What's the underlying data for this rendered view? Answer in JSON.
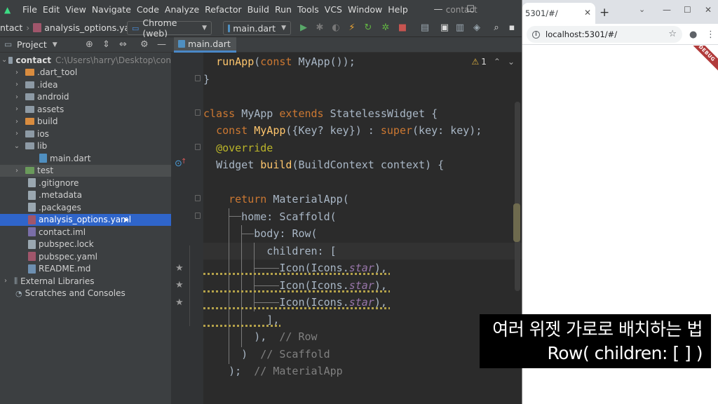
{
  "ide": {
    "menu": [
      "File",
      "Edit",
      "View",
      "Navigate",
      "Code",
      "Analyze",
      "Refactor",
      "Build",
      "Run",
      "Tools",
      "VCS",
      "Window",
      "Help"
    ],
    "project_name": "contact",
    "breadcrumb": {
      "root": "ntact",
      "file": "analysis_options.yaml"
    },
    "device_selector": "Chrome (web)",
    "run_config": "main.dart",
    "project_panel_label": "Project",
    "tree": [
      {
        "label": "contact",
        "path": "C:\\Users\\harry\\Desktop\\con",
        "icon": "folder",
        "expanded": true,
        "depth": 0
      },
      {
        "label": ".dart_tool",
        "icon": "folder-orange",
        "depth": 1
      },
      {
        "label": ".idea",
        "icon": "folder",
        "depth": 1
      },
      {
        "label": "android",
        "icon": "folder",
        "depth": 1
      },
      {
        "label": "assets",
        "icon": "folder",
        "depth": 1
      },
      {
        "label": "build",
        "icon": "folder-orange",
        "depth": 1
      },
      {
        "label": "ios",
        "icon": "folder",
        "depth": 1
      },
      {
        "label": "lib",
        "icon": "folder",
        "expanded": true,
        "depth": 1
      },
      {
        "label": "main.dart",
        "icon": "dart-file",
        "depth": 2
      },
      {
        "label": "test",
        "icon": "folder-test",
        "depth": 1,
        "state": "hover"
      },
      {
        "label": ".gitignore",
        "icon": "file",
        "depth": 1
      },
      {
        "label": ".metadata",
        "icon": "file",
        "depth": 1
      },
      {
        "label": ".packages",
        "icon": "file",
        "depth": 1
      },
      {
        "label": "analysis_options.yaml",
        "icon": "yaml-file",
        "depth": 1,
        "state": "selected"
      },
      {
        "label": "contact.iml",
        "icon": "iml-file",
        "depth": 1
      },
      {
        "label": "pubspec.lock",
        "icon": "file",
        "depth": 1
      },
      {
        "label": "pubspec.yaml",
        "icon": "yaml-file",
        "depth": 1
      },
      {
        "label": "README.md",
        "icon": "md-file",
        "depth": 1
      },
      {
        "label": "External Libraries",
        "icon": "library",
        "depth": 0
      },
      {
        "label": "Scratches and Consoles",
        "icon": "scratches",
        "depth": 0
      }
    ],
    "editor_tab": "main.dart",
    "warnings_count": "1",
    "code": [
      "  runApp(const MyApp());",
      "}",
      "",
      "class MyApp extends StatelessWidget {",
      "  const MyApp({Key? key}) : super(key: key);",
      "  @override",
      "  Widget build(BuildContext context) {",
      "",
      "    return MaterialApp(",
      "      home: Scaffold(",
      "        body: Row(",
      "          children: [",
      "            Icon(Icons.star),",
      "            Icon(Icons.star),",
      "            Icon(Icons.star),",
      "          ],",
      "        ),  // Row",
      "      )  // Scaffold",
      "    );  // MaterialApp"
    ]
  },
  "browser": {
    "tab_title": "5301/#/",
    "url": "localhost:5301/#/",
    "debug_banner": "DEBUG"
  },
  "caption": {
    "line1": "여러 위젯 가로로 배치하는 법",
    "line2": "Row( children: [ ] )"
  },
  "colors": {
    "ide_bg": "#2b2b2b",
    "panel_bg": "#3c3f41",
    "selection": "#2f65ca",
    "keyword": "#cc7832",
    "function": "#ffc66d",
    "annotation": "#bbb529",
    "static_prop": "#9876aa",
    "comment": "#808080"
  }
}
